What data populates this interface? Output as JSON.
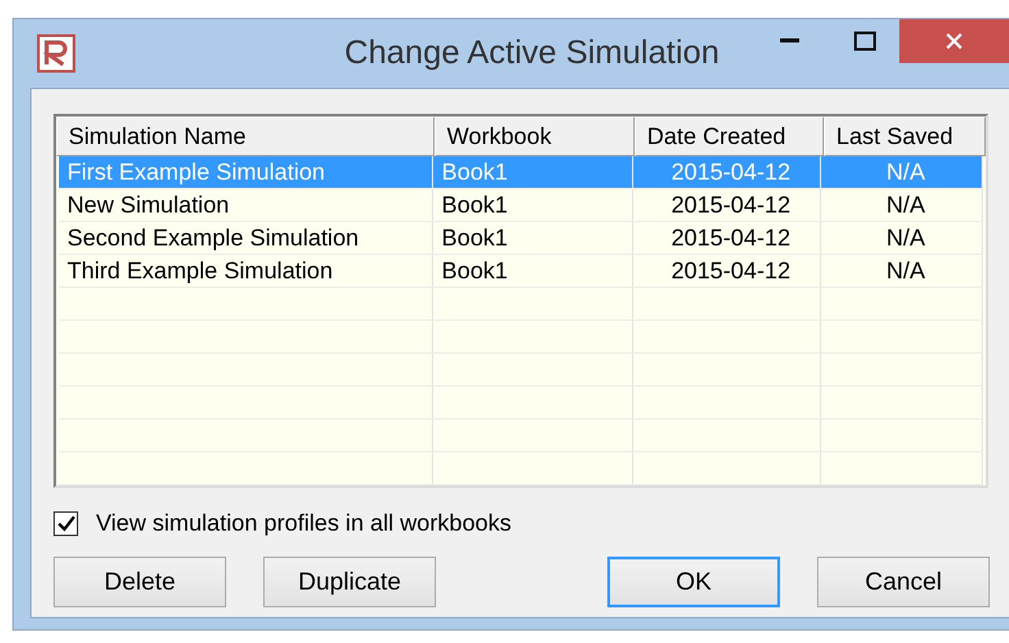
{
  "window": {
    "title": "Change Active Simulation"
  },
  "table": {
    "columns": [
      "Simulation Name",
      "Workbook",
      "Date Created",
      "Last Saved"
    ],
    "rows": [
      {
        "cells": [
          "First Example Simulation",
          "Book1",
          "2015-04-12",
          "N/A"
        ],
        "selected": true
      },
      {
        "cells": [
          "New Simulation",
          "Book1",
          "2015-04-12",
          "N/A"
        ],
        "selected": false
      },
      {
        "cells": [
          "Second Example Simulation",
          "Book1",
          "2015-04-12",
          "N/A"
        ],
        "selected": false
      },
      {
        "cells": [
          "Third Example Simulation",
          "Book1",
          "2015-04-12",
          "N/A"
        ],
        "selected": false
      }
    ]
  },
  "checkbox": {
    "label": "View simulation profiles in all workbooks",
    "checked": true
  },
  "buttons": [
    {
      "label": "Delete",
      "default": false
    },
    {
      "label": "Duplicate",
      "default": false
    },
    {
      "label": "OK",
      "default": true
    },
    {
      "label": "Cancel",
      "default": false
    }
  ]
}
